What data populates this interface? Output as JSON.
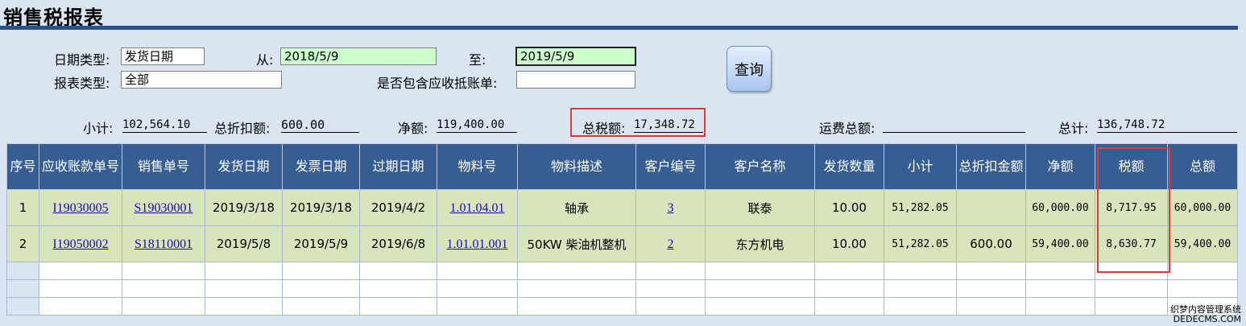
{
  "title": "销售税报表",
  "form": {
    "date_type_label": "日期类型:",
    "date_type_value": "发货日期",
    "from_label": "从:",
    "from_value": "2018/5/9",
    "to_label": "至:",
    "to_value": "2019/5/9",
    "report_type_label": "报表类型:",
    "report_type_value": "全部",
    "include_ar_label": "是否包含应收抵账单:",
    "include_ar_value": "",
    "query_button": "查询"
  },
  "summary": {
    "subtotal_label": "小计:",
    "subtotal_value": "102,564.10",
    "discount_label": "总折扣额:",
    "discount_value": "600.00",
    "net_label": "净额:",
    "net_value": "119,400.00",
    "tax_label": "总税额:",
    "tax_value": "17,348.72",
    "freight_label": "运费总额:",
    "freight_value": "",
    "total_label": "总计:",
    "total_value": "136,748.72"
  },
  "table": {
    "headers": [
      "序号",
      "应收账款单号",
      "销售单号",
      "发货日期",
      "发票日期",
      "过期日期",
      "物料号",
      "物料描述",
      "客户编号",
      "客户名称",
      "发货数量",
      "小计",
      "总折扣金额",
      "净额",
      "税额",
      "总额"
    ],
    "rows": [
      [
        "1",
        "I19030005",
        "S19030001",
        "2019/3/18",
        "2019/3/18",
        "2019/4/2",
        "1.01.04.01",
        "轴承",
        "3",
        "联泰",
        "10.00",
        "51,282.05",
        "",
        "60,000.00",
        "8,717.95",
        "60,000.00"
      ],
      [
        "2",
        "I19050002",
        "S18110001",
        "2019/5/8",
        "2019/5/9",
        "2019/6/8",
        "1.01.01.001",
        "50KW 柴油机整机",
        "2",
        "东方机电",
        "10.00",
        "51,282.05",
        "600.00",
        "59,400.00",
        "8,630.77",
        "59,400.00"
      ]
    ]
  },
  "watermark": {
    "line1": "织梦内容管理系统",
    "line2": "DEDECMS.COM"
  },
  "colors": {
    "header_bg": "#365d94",
    "row_bg": "#d8e4bc",
    "highlight": "#e53935",
    "page_bg": "#dbe5f1"
  }
}
